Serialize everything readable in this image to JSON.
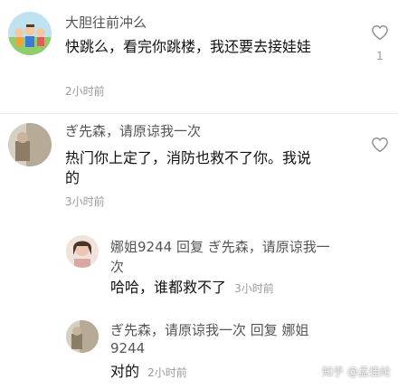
{
  "comments": [
    {
      "username": "大胆往前冲么",
      "text_lines": [
        "快跳么，看完你跳楼，我还要去接娃娃"
      ],
      "time": "2小时前",
      "like_count": "1"
    },
    {
      "username": "ぎ先森，请原谅我一次",
      "text_lines": [
        "热门你上定了，消防也救不了你。我说",
        "的"
      ],
      "time": "3小时前",
      "like_count": ""
    }
  ],
  "replies": [
    {
      "header_lines": [
        "娜姐9244  回复  ぎ先森，请原谅我一",
        "次"
      ],
      "text": "哈哈，谁都救不了",
      "time": "3小时前"
    },
    {
      "header_lines": [
        "ぎ先森，请原谅我一次  回复  娜姐",
        "9244"
      ],
      "text": "对的",
      "time": "2小时前"
    }
  ],
  "watermark": {
    "text": "知乎 @孟佳纶"
  },
  "colors": {
    "background": "#ffffff",
    "text": "#111111",
    "name": "#555555",
    "meta": "#9a9a9a",
    "divider": "#eeeeee"
  }
}
